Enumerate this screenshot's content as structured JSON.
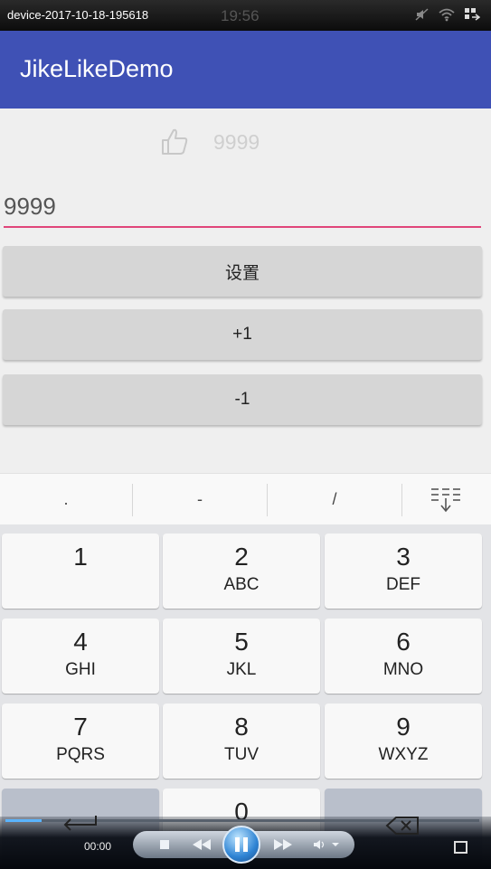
{
  "status_bar": {
    "title": "device-2017-10-18-195618",
    "time": "19:56",
    "icons": [
      "mute-icon",
      "wifi-icon",
      "grid-icon"
    ]
  },
  "app_bar": {
    "title": "JikeLikeDemo"
  },
  "like_widget": {
    "icon": "thumbs-up-icon",
    "count": "9999"
  },
  "edit_field": {
    "value": "9999",
    "accent_color": "#e0457a"
  },
  "buttons": {
    "set": "设置",
    "plus_one": "+1",
    "minus_one": "-1"
  },
  "keyboard": {
    "toolbar": [
      ".",
      "-",
      "/"
    ],
    "toolbar_icon": "collapse-keyboard-icon",
    "keys": [
      {
        "digit": "1",
        "letters": ""
      },
      {
        "digit": "2",
        "letters": "ABC"
      },
      {
        "digit": "3",
        "letters": "DEF"
      },
      {
        "digit": "4",
        "letters": "GHI"
      },
      {
        "digit": "5",
        "letters": "JKL"
      },
      {
        "digit": "6",
        "letters": "MNO"
      },
      {
        "digit": "7",
        "letters": "PQRS"
      },
      {
        "digit": "8",
        "letters": "TUV"
      },
      {
        "digit": "9",
        "letters": "WXYZ"
      },
      {
        "digit": "0",
        "letters": ""
      }
    ],
    "enter_icon": "enter-icon",
    "backspace_icon": "backspace-icon"
  },
  "media_player": {
    "time": "00:00",
    "icons": [
      "stop-icon",
      "rewind-icon",
      "pause-icon",
      "fast-forward-icon",
      "volume-icon",
      "fullscreen-icon"
    ]
  },
  "colors": {
    "app_bar": "#3f51b5",
    "accent": "#e0457a"
  }
}
